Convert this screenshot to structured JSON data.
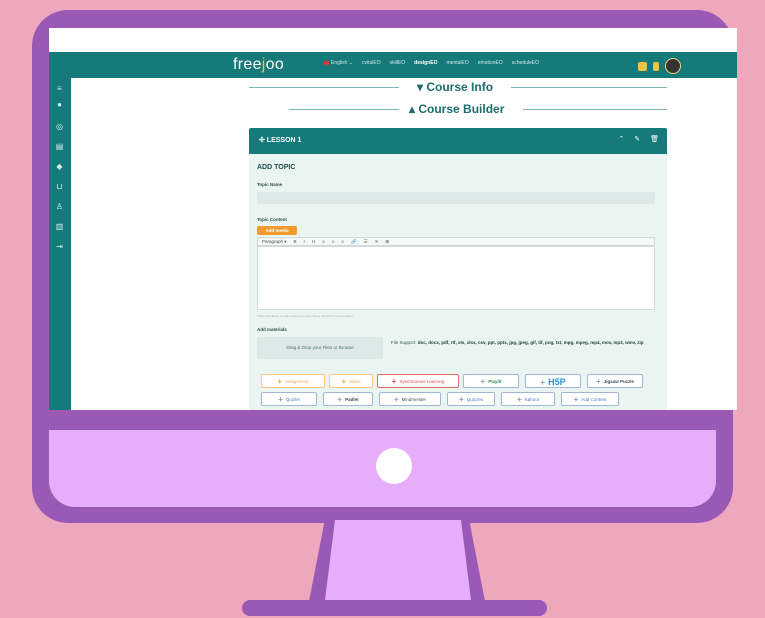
{
  "topbar": {
    "logo": "freejoo",
    "nav": [
      "English ⌄",
      "cvitalEO",
      "skillEO",
      "designEO",
      "mentalEO",
      "emotionEO",
      "scheduleEO"
    ],
    "active_nav": "designEO"
  },
  "sections": {
    "course_info": "▾ Course Info",
    "course_builder": "▴ Course Builder"
  },
  "lesson": {
    "title": "✣ LESSON 1",
    "actions": [
      "⌃",
      "✎",
      "🗑"
    ]
  },
  "topic": {
    "heading": "ADD TOPIC",
    "name_label": "Topic Name",
    "content_label": "Topic Content",
    "add_media": "Add media",
    "toolbar": [
      "Paragraph ▾",
      "B",
      "I",
      "H",
      "≡",
      "≡",
      "≡",
      "🔗",
      "☰",
      "✕",
      "⊞"
    ],
    "hint": "Press Ctrl+Enter to add a lesson or topic. Press Alt+F10 to focus toolbar."
  },
  "materials": {
    "label": "Add materials",
    "dropzone": "Drag & Drop your Files or Browse",
    "file_support_label": "File Support:",
    "file_support_types": "doc, docx, pdf, rtf, xls, xlsx, csv, ppt, pptx, jpg, jpeg, gif, tif, png, txt, mpg, mpeg, mp4, mov, mp3, wmv, zip",
    "buttons_row1": [
      "Assignment",
      "Video",
      "Synchronous Learning",
      "Playlit",
      "H5P",
      "Jigsaw Puzzle"
    ],
    "buttons_row2": [
      "Quizlet",
      "Padlet",
      "Mindmeister",
      "Quizzes",
      "Kahoot",
      "Add Content"
    ]
  },
  "colors": {
    "teal": "#157a79",
    "orange": "#f29a2e",
    "red": "#e04a4a",
    "bezel": "#9b59b6",
    "background": "#eea8bd",
    "chin": "#e6aefa"
  }
}
